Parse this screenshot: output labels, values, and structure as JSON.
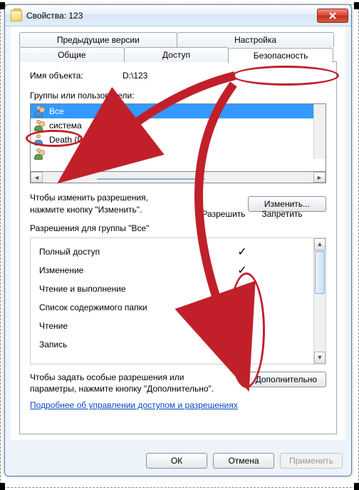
{
  "window": {
    "title": "Свойства: 123"
  },
  "tabs": {
    "row1": [
      "Предыдущие версии",
      "Настройка"
    ],
    "row2": [
      "Общие",
      "Доступ",
      "Безопасность"
    ],
    "active": "Безопасность"
  },
  "object": {
    "label": "Имя объекта:",
    "value": "D:\\123"
  },
  "groups": {
    "label": "Группы или пользователи:",
    "items": [
      {
        "name": "Все",
        "selected": true,
        "icon": "multi"
      },
      {
        "name": "система",
        "selected": false,
        "icon": "multi"
      },
      {
        "name": "Death (Death-C2D\\Death)",
        "selected": false,
        "icon": "single"
      }
    ]
  },
  "change": {
    "text_line1": "Чтобы изменить разрешения,",
    "text_line2": "нажмите кнопку \"Изменить\".",
    "button": "Изменить..."
  },
  "perms": {
    "label_prefix": "Разрешения для группы",
    "label_group": "\"Все\"",
    "col_allow": "Разрешить",
    "col_deny": "Запретить",
    "rows": [
      {
        "name": "Полный доступ",
        "allow": true,
        "deny": false
      },
      {
        "name": "Изменение",
        "allow": true,
        "deny": false
      },
      {
        "name": "Чтение и выполнение",
        "allow": true,
        "deny": false
      },
      {
        "name": "Список содержимого папки",
        "allow": true,
        "deny": false
      },
      {
        "name": "Чтение",
        "allow": true,
        "deny": false
      },
      {
        "name": "Запись",
        "allow": true,
        "deny": false
      }
    ]
  },
  "advanced": {
    "text": "Чтобы задать особые разрешения или параметры, нажмите кнопку \"Дополнительно\".",
    "button": "Дополнительно"
  },
  "link": "Подробнее об управлении доступом и разрешениях",
  "dialog_buttons": {
    "ok": "ОК",
    "cancel": "Отмена",
    "apply": "Применить"
  }
}
